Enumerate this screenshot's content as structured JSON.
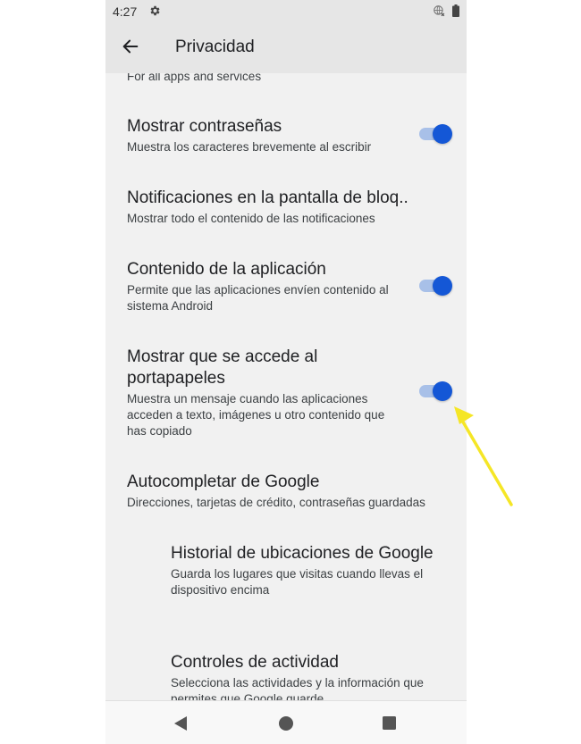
{
  "status_bar": {
    "time": "4:27"
  },
  "app_bar": {
    "title": "Privacidad"
  },
  "settings": {
    "partial_subtitle": "For all apps and services",
    "items": [
      {
        "title": "Mostrar contraseñas",
        "subtitle": "Muestra los caracteres brevemente al escribir",
        "toggle_on": true
      },
      {
        "title": "Notificaciones en la pantalla de bloq..",
        "subtitle": "Mostrar todo el contenido de las notificaciones"
      },
      {
        "title": "Contenido de la aplicación",
        "subtitle": "Permite que las aplicaciones envíen contenido al sistema Android",
        "toggle_on": true
      },
      {
        "title": "Mostrar que se accede al portapapeles",
        "subtitle": "Muestra un mensaje cuando las aplicaciones acceden a texto, imágenes u otro contenido que has copiado",
        "toggle_on": true
      },
      {
        "title": "Autocompletar de Google",
        "subtitle": "Direcciones, tarjetas de crédito, contraseñas guardadas"
      },
      {
        "title": "Historial de ubicaciones de Google",
        "subtitle": "Guarda los lugares que visitas cuando llevas el dispositivo encima"
      },
      {
        "title": "Controles de actividad",
        "subtitle": "Selecciona las actividades y la información que permites que Google guarde"
      }
    ]
  },
  "colors": {
    "accent": "#1457d6",
    "track": "#a8c0e8",
    "annotation_arrow": "#f5e626"
  },
  "icons": [
    "gear-icon",
    "globe-icon",
    "battery-icon",
    "back-arrow-icon",
    "nav-back-icon",
    "nav-home-icon",
    "nav-recent-icon"
  ]
}
